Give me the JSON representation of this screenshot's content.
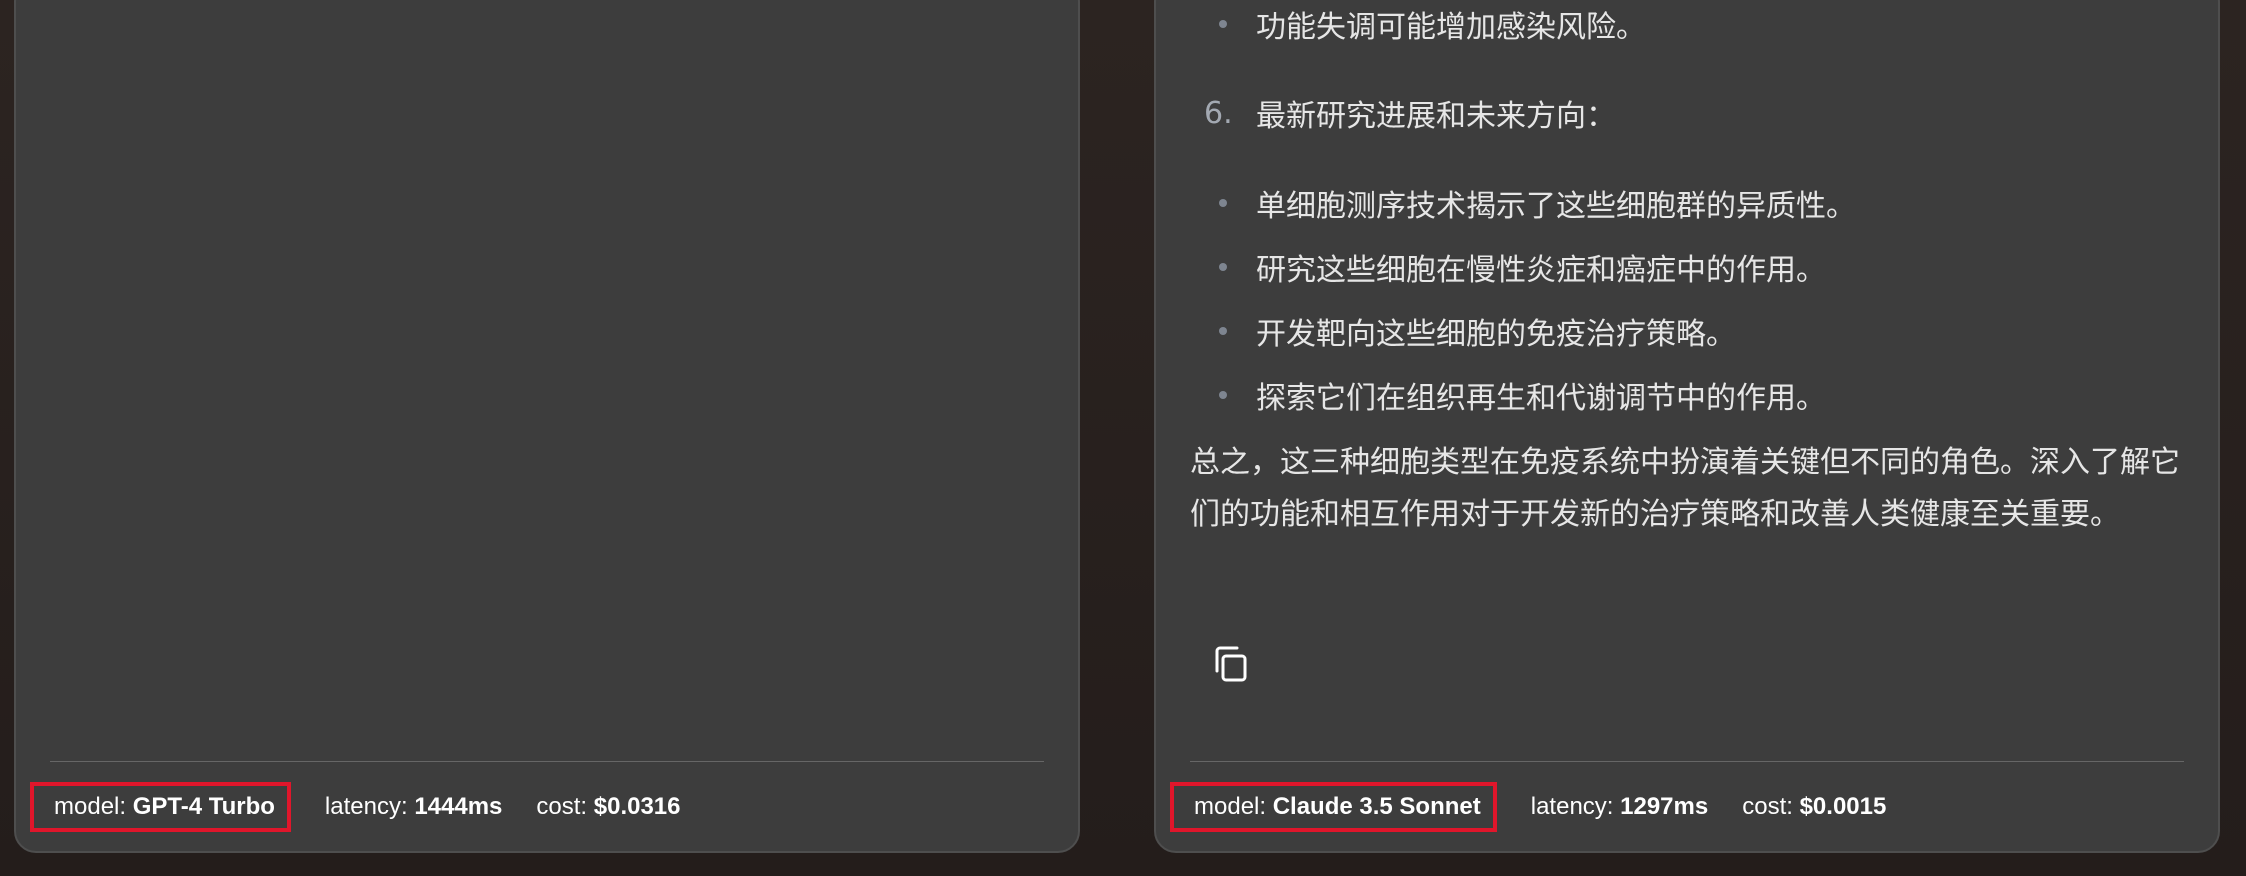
{
  "left_panel": {
    "footer": {
      "model_label": "model: ",
      "model_value": "GPT-4 Turbo",
      "latency_label": "latency: ",
      "latency_value": "1444ms",
      "cost_label": "cost: ",
      "cost_value": "$0.0316"
    }
  },
  "right_panel": {
    "bullets_top": [
      "功能失调可能增加感染风险。"
    ],
    "section_number": "6.",
    "section_heading": "最新研究进展和未来方向：",
    "bullets": [
      "单细胞测序技术揭示了这些细胞群的异质性。",
      "研究这些细胞在慢性炎症和癌症中的作用。",
      "开发靶向这些细胞的免疫治疗策略。",
      "探索它们在组织再生和代谢调节中的作用。"
    ],
    "summary": "总之，这三种细胞类型在免疫系统中扮演着关键但不同的角色。深入了解它们的功能和相互作用对于开发新的治疗策略和改善人类健康至关重要。",
    "copy_icon": "copy-icon",
    "footer": {
      "model_label": "model: ",
      "model_value": "Claude 3.5 Sonnet",
      "latency_label": "latency: ",
      "latency_value": "1297ms",
      "cost_label": "cost: ",
      "cost_value": "$0.0015"
    }
  },
  "colors": {
    "panel_bg": "#3d3d3d",
    "highlight_border": "#e0162b",
    "bullet_dot": "#7e8590"
  }
}
